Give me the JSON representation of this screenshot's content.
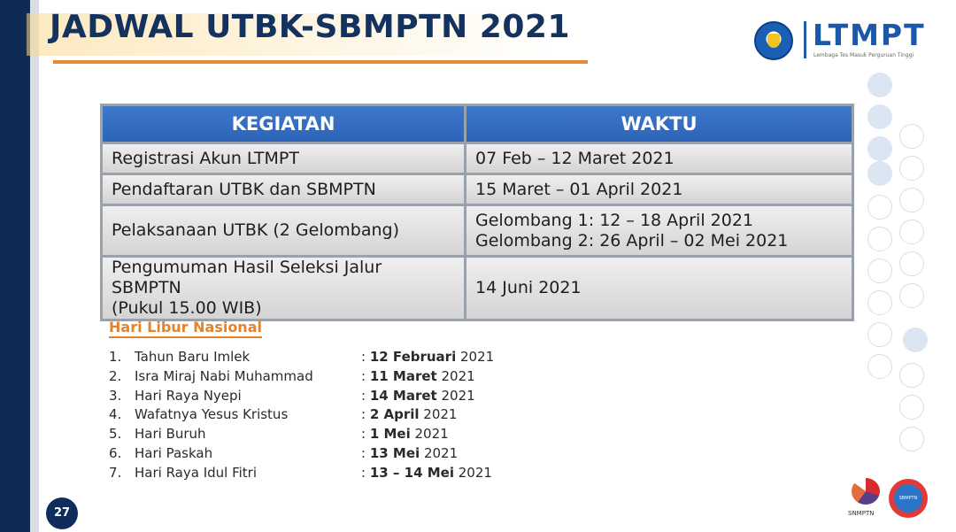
{
  "header": {
    "title": "JADWAL UTBK-SBMPTN 2021",
    "logo_text": "LTMPT",
    "logo_subtitle": "Lembaga Tes Masuk Perguruan Tinggi"
  },
  "schedule": {
    "headers": [
      "KEGIATAN",
      "WAKTU"
    ],
    "rows": [
      {
        "activity": "Registrasi Akun LTMPT",
        "time": "07 Feb – 12 Maret 2021"
      },
      {
        "activity": "Pendaftaran UTBK dan SBMPTN",
        "time": "15 Maret – 01 April 2021"
      },
      {
        "activity": "Pelaksanaan UTBK (2 Gelombang)",
        "time_line1": "Gelombang 1: 12 – 18 April 2021",
        "time_line2": "Gelombang 2: 26 April – 02 Mei 2021"
      },
      {
        "activity_line1": "Pengumuman Hasil Seleksi Jalur SBMPTN",
        "activity_line2": "(Pukul 15.00 WIB)",
        "time": "14 Juni 2021"
      }
    ]
  },
  "holidays": {
    "title": "Hari Libur Nasional",
    "items": [
      {
        "num": "1.",
        "name": "Tahun Baru Imlek",
        "sep": ": ",
        "date_bold": "12 Februari",
        "year": " 2021"
      },
      {
        "num": "2.",
        "name": "Isra Miraj Nabi Muhammad",
        "sep": ": ",
        "date_bold": "11 Maret",
        "year": " 2021"
      },
      {
        "num": "3.",
        "name": "Hari Raya Nyepi",
        "sep": ": ",
        "date_bold": "14 Maret",
        "year": " 2021"
      },
      {
        "num": "4.",
        "name": "Wafatnya Yesus Kristus",
        "sep": ": ",
        "date_bold": "2 April",
        "year": " 2021"
      },
      {
        "num": "5.",
        "name": "Hari Buruh",
        "sep": ": ",
        "date_bold": "1 Mei",
        "year": " 2021"
      },
      {
        "num": "6.",
        "name": "Hari Paskah",
        "sep": ": ",
        "date_bold": "13 Mei",
        "year": " 2021"
      },
      {
        "num": "7.",
        "name": "Hari Raya Idul Fitri",
        "sep": ": ",
        "date_bold": "13 – 14 Mei",
        "year": " 2021"
      }
    ]
  },
  "footer": {
    "page_number": "27",
    "snmptn_label": "SNMPTN",
    "sbmptn_label": "SBMPTN"
  },
  "colors": {
    "title": "#14325f",
    "accent_orange": "#e58a35",
    "header_blue": "#2c64b8",
    "logo_blue": "#1b58a8"
  }
}
